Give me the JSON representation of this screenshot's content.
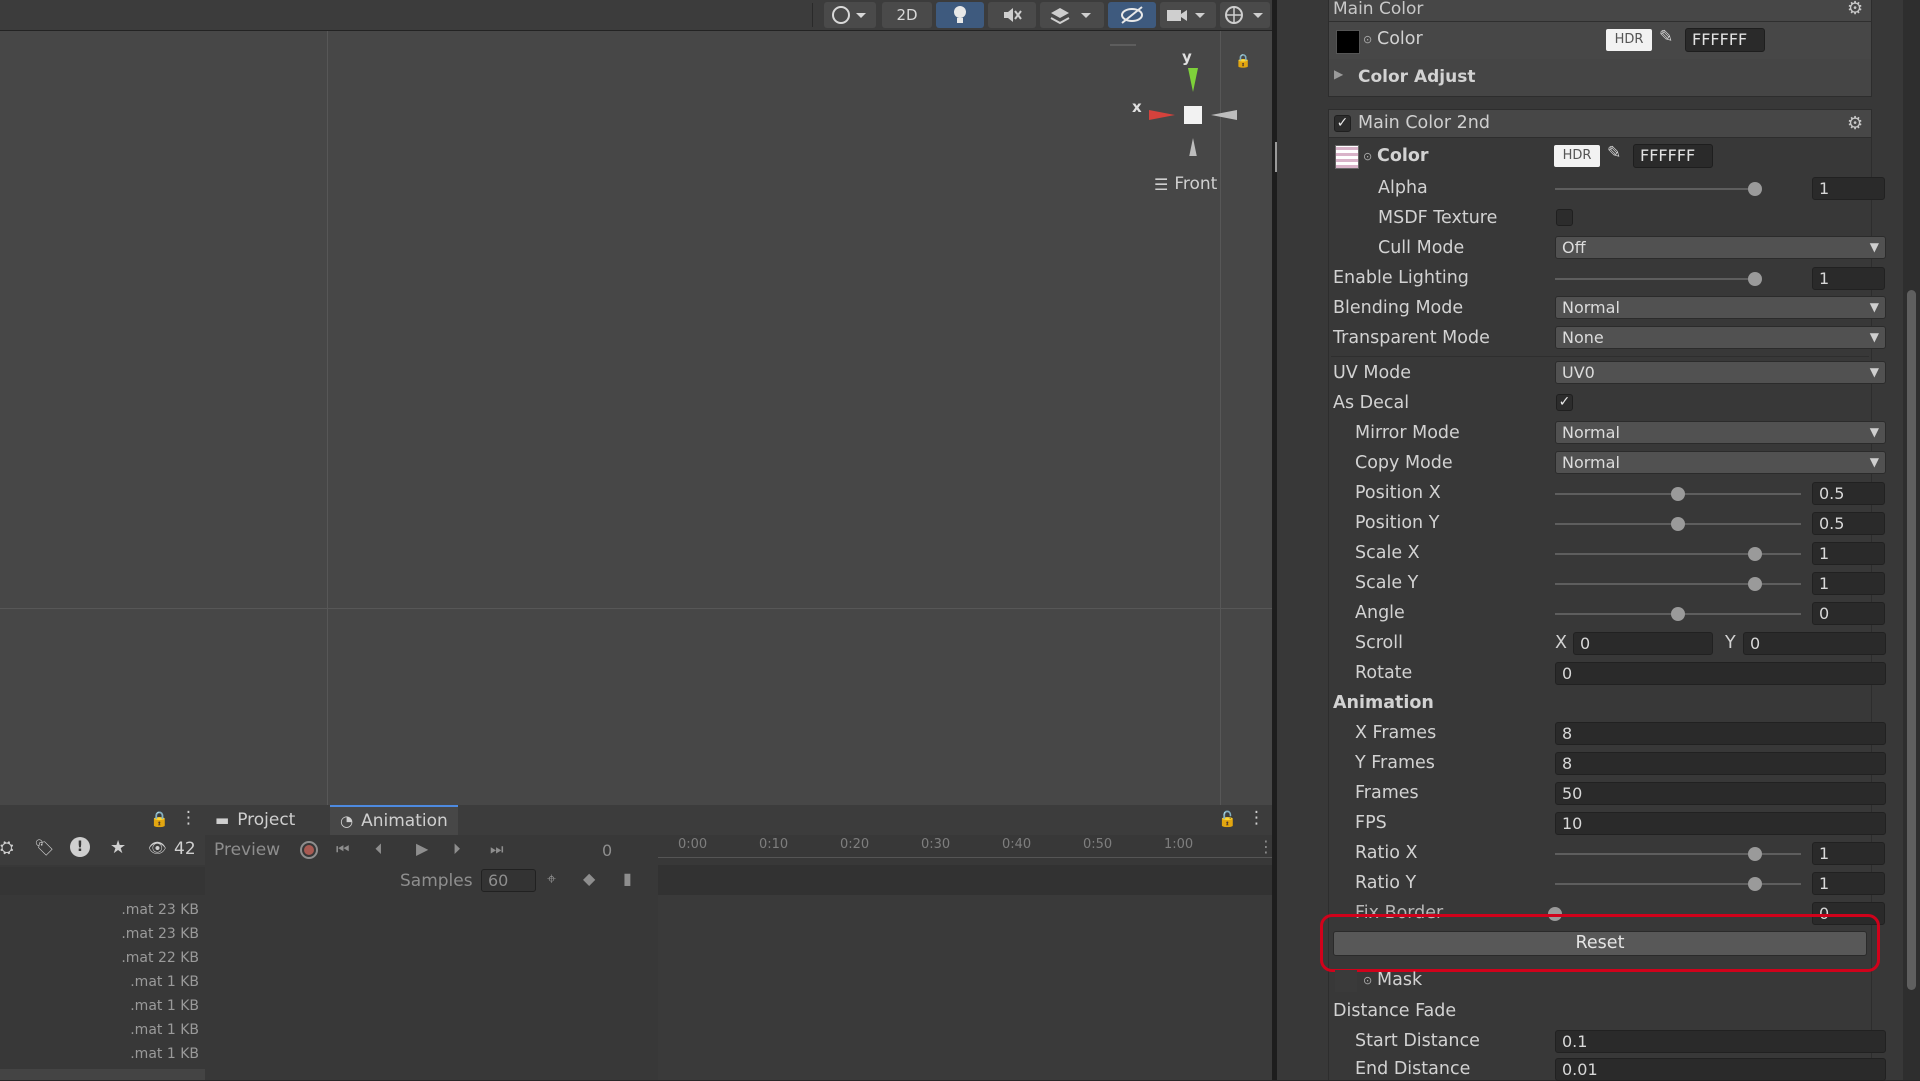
{
  "scene": {
    "toolbar": {
      "btn_2d": "2D"
    },
    "gizmo": {
      "y": "y",
      "x": "x",
      "view_label": "Front"
    }
  },
  "left_pane": {
    "hidden_count": "42",
    "assets": [
      {
        "ext": ".mat",
        "size": "23 KB"
      },
      {
        "ext": ".mat",
        "size": "23 KB"
      },
      {
        "ext": ".mat",
        "size": "22 KB"
      },
      {
        "ext": ".mat",
        "size": "1 KB"
      },
      {
        "ext": ".mat",
        "size": "1 KB"
      },
      {
        "ext": ".mat",
        "size": "1 KB"
      },
      {
        "ext": ".mat",
        "size": "1 KB"
      }
    ]
  },
  "animation": {
    "tabs": [
      "Project",
      "Animation"
    ],
    "preview_label": "Preview",
    "frame_value": "0",
    "samples_label": "Samples",
    "samples_value": "60",
    "timeline_ticks": [
      "0:00",
      "0:10",
      "0:20",
      "0:30",
      "0:40",
      "0:50",
      "1:00"
    ]
  },
  "inspector": {
    "main_color": {
      "title": "Main Color",
      "color_label": "Color",
      "hdr": "HDR",
      "hex": "FFFFFF",
      "color_adjust": "Color Adjust"
    },
    "main_color_2nd": {
      "title": "Main Color 2nd",
      "color_label": "Color",
      "hdr": "HDR",
      "hex": "FFFFFF",
      "alpha_label": "Alpha",
      "alpha_value": "1",
      "alpha_level": 1.0,
      "msdf_label": "MSDF Texture",
      "cull_label": "Cull Mode",
      "cull_value": "Off",
      "lighting_label": "Enable Lighting",
      "lighting_value": "1",
      "lighting_level": 1.0,
      "blending_label": "Blending Mode",
      "blending_value": "Normal",
      "transparent_label": "Transparent Mode",
      "transparent_value": "None",
      "uv_label": "UV Mode",
      "uv_value": "UV0",
      "decal_label": "As Decal",
      "mirror_label": "Mirror Mode",
      "mirror_value": "Normal",
      "copy_label": "Copy Mode",
      "copy_value": "Normal",
      "posx_label": "Position X",
      "posx_value": "0.5",
      "posx_level": 0.5,
      "posy_label": "Position Y",
      "posy_value": "0.5",
      "posy_level": 0.5,
      "scalex_label": "Scale X",
      "scalex_value": "1",
      "scalex_level": 1.0,
      "scaley_label": "Scale Y",
      "scaley_value": "1",
      "scaley_level": 1.0,
      "angle_label": "Angle",
      "angle_value": "0",
      "angle_level": 0.5,
      "scroll_label": "Scroll",
      "scroll_x_label": "X",
      "scroll_x_value": "0",
      "scroll_y_label": "Y",
      "scroll_y_value": "0",
      "rotate_label": "Rotate",
      "rotate_value": "0",
      "animation_header": "Animation",
      "xframes_label": "X Frames",
      "xframes_value": "8",
      "yframes_label": "Y Frames",
      "yframes_value": "8",
      "frames_label": "Frames",
      "frames_value": "50",
      "fps_label": "FPS",
      "fps_value": "10",
      "ratiox_label": "Ratio X",
      "ratiox_value": "1",
      "ratiox_level": 1.0,
      "ratioy_label": "Ratio Y",
      "ratioy_value": "1",
      "ratioy_level": 1.0,
      "fixborder_label": "Fix Border",
      "fixborder_value": "0",
      "fixborder_level": 0.0,
      "reset_label": "Reset",
      "mask_label": "Mask",
      "distance_fade_label": "Distance Fade",
      "start_label": "Start Distance",
      "start_value": "0.1",
      "end_label": "End Distance",
      "end_value": "0.01"
    },
    "colors": {
      "highlight": "#d0021b",
      "accent": "#4d8ae0"
    }
  }
}
